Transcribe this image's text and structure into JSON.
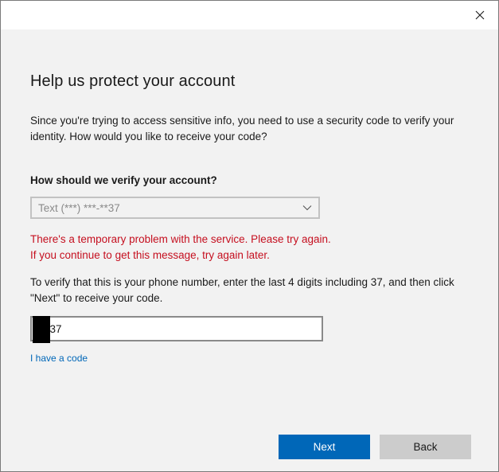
{
  "window": {
    "close_icon": "close-icon"
  },
  "dialog": {
    "heading": "Help us protect your account",
    "description": "Since you're trying to access sensitive info, you need to use a security code to verify your identity. How would you like to receive your code?",
    "question": "How should we verify your account?",
    "method_select": {
      "selected": "Text (***) ***-**37",
      "icon": "chevron-down-icon"
    },
    "error": "There's a temporary problem with the service. Please try again. If you continue to get this message, try again later.",
    "instruction": "To verify that this is your phone number, enter the last 4 digits including 37, and then click \"Next\" to receive your code.",
    "digits_input": {
      "value": "**37"
    },
    "have_code_link": "I have a code",
    "next_label": "Next",
    "back_label": "Back"
  },
  "colors": {
    "accent": "#0067b8",
    "error": "#c50f1f",
    "background": "#f2f2f2",
    "back_button": "#cccccc"
  }
}
